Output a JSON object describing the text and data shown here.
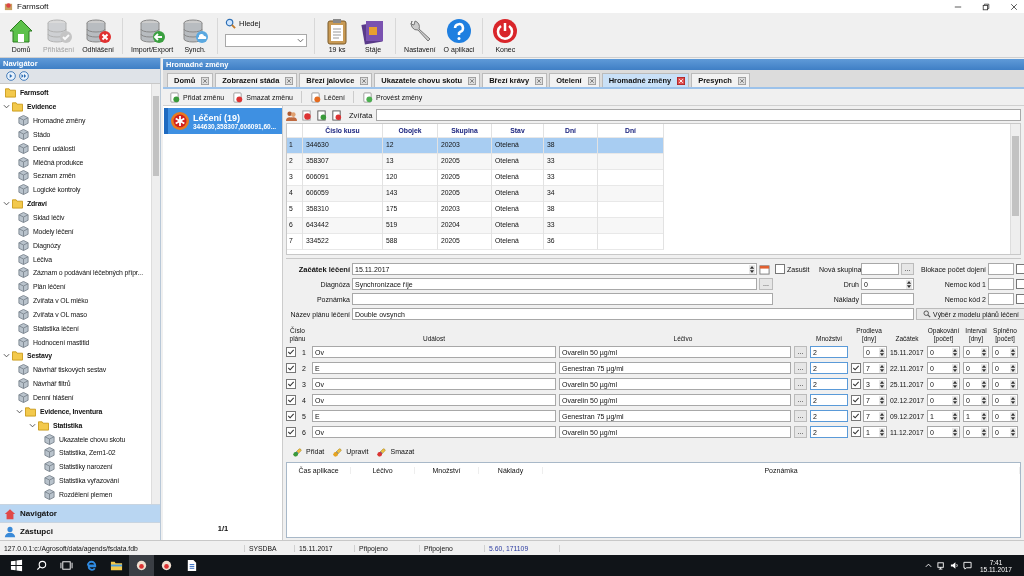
{
  "window": {
    "title": "Farmsoft"
  },
  "toolbar": {
    "buttons": [
      {
        "label": "Domů",
        "disabled": false
      },
      {
        "label": "Přihlášení",
        "disabled": true
      },
      {
        "label": "Odhlášení",
        "disabled": false
      },
      {
        "label": "Import/Export",
        "disabled": false
      },
      {
        "label": "Synch.",
        "disabled": false
      }
    ],
    "search": {
      "label": "Hledej"
    },
    "buttons_right": [
      {
        "label": "19 ks",
        "disabled": false
      },
      {
        "label": "Stáje",
        "disabled": false
      },
      {
        "label": "Nastavení",
        "disabled": false
      },
      {
        "label": "O aplikaci",
        "disabled": false
      },
      {
        "label": "Konec",
        "disabled": false
      }
    ]
  },
  "navigator": {
    "title": "Navigátor",
    "tree": [
      {
        "label": "Farmsoft",
        "children": [
          {
            "label": "Evidence",
            "expanded": true,
            "children": [
              {
                "label": "Hromadné změny"
              },
              {
                "label": "Stádo"
              },
              {
                "label": "Denní události"
              },
              {
                "label": "Mléčná produkce"
              },
              {
                "label": "Seznam změn"
              },
              {
                "label": "Logické kontroly"
              }
            ]
          },
          {
            "label": "Zdraví",
            "expanded": true,
            "children": [
              {
                "label": "Sklad léčiv"
              },
              {
                "label": "Modely léčení"
              },
              {
                "label": "Diagnózy"
              },
              {
                "label": "Léčiva"
              },
              {
                "label": "Záznam o podávání léčebných přípr..."
              },
              {
                "label": "Plán léčení"
              },
              {
                "label": "Zvířata v OL mléko"
              },
              {
                "label": "Zvířata v OL maso"
              },
              {
                "label": "Statistika léčení"
              },
              {
                "label": "Hodnocení mastitid"
              }
            ]
          },
          {
            "label": "Sestavy",
            "expanded": true,
            "children": [
              {
                "label": "Návrhář tiskových sestav"
              },
              {
                "label": "Návrhář filtrů"
              },
              {
                "label": "Denní hlášení"
              },
              {
                "label": "Evidence, Inventura",
                "expanded": true,
                "children": [
                  {
                    "label": "Statistika",
                    "expanded": true,
                    "children": [
                      {
                        "label": "Ukazatele chovu skotu"
                      },
                      {
                        "label": "Statistika, Zem1-02"
                      },
                      {
                        "label": "Statistiky narození"
                      },
                      {
                        "label": "Statistika vyřazování"
                      },
                      {
                        "label": "Rozdělení plemen"
                      }
                    ]
                  }
                ]
              }
            ]
          }
        ]
      }
    ],
    "sections": [
      {
        "label": "Navigátor",
        "selected": true
      },
      {
        "label": "Zástupci",
        "selected": false
      }
    ]
  },
  "main": {
    "title": "Hromadné změny",
    "tabs": [
      {
        "label": "Domů",
        "selected": false
      },
      {
        "label": "Zobrazení stáda",
        "selected": false
      },
      {
        "label": "Březí jalovice",
        "selected": false
      },
      {
        "label": "Ukazatele chovu skotu",
        "selected": false
      },
      {
        "label": "Březí krávy",
        "selected": false
      },
      {
        "label": "Otelení",
        "selected": false
      },
      {
        "label": "Hromadné změny",
        "selected": true
      },
      {
        "label": "Presynch",
        "selected": false
      }
    ],
    "actions": [
      {
        "label": "Přidat změnu"
      },
      {
        "label": "Smazat změnu"
      },
      {
        "label": "Léčení"
      },
      {
        "label": "Provést změny"
      }
    ],
    "changes": [
      {
        "title": "Léčení (19)",
        "detail": "344630,358307,606091,60...",
        "selected": true
      }
    ],
    "pager": "1/1",
    "animals": {
      "filter_label": "Zvířata",
      "columns": [
        "Číslo kusu",
        "Obojek",
        "Skupina",
        "Stav",
        "Dní",
        "Dní"
      ],
      "rows": [
        {
          "number": "1",
          "cells": [
            "344630",
            "12",
            "20203",
            "Otelená",
            "38"
          ],
          "selected": true
        },
        {
          "number": "2",
          "cells": [
            "358307",
            "13",
            "20205",
            "Otelená",
            "33"
          ],
          "selected": false
        },
        {
          "number": "3",
          "cells": [
            "606091",
            "120",
            "20205",
            "Otelená",
            "33"
          ],
          "selected": false
        },
        {
          "number": "4",
          "cells": [
            "606059",
            "143",
            "20205",
            "Otelená",
            "34"
          ],
          "selected": false
        },
        {
          "number": "5",
          "cells": [
            "358310",
            "175",
            "20203",
            "Otelená",
            "38"
          ],
          "selected": false
        },
        {
          "number": "6",
          "cells": [
            "643442",
            "519",
            "20204",
            "Otelená",
            "33"
          ],
          "selected": false
        },
        {
          "number": "7",
          "cells": [
            "334522",
            "588",
            "20205",
            "Otelená",
            "36"
          ],
          "selected": false
        }
      ]
    },
    "treatment": {
      "start_label": "Začátek léčení",
      "start": "15.11.2017",
      "dry_off_label": "Zasušit",
      "dry_off_checked": false,
      "new_group_label": "Nová skupina",
      "new_group_button": "...",
      "diagnosis_button": "...",
      "block_label": "Blokace počet dojení",
      "block_checked": false,
      "diagnosis_label": "Diagnóza",
      "diagnosis": "Synchronizace říje",
      "type_label": "Druh",
      "type_value": "0",
      "disease1_label": "Nemoc kód 1",
      "disease1_checked": false,
      "note_label": "Poznámka",
      "costs_label": "Náklady",
      "disease2_label": "Nemoc kód 2",
      "disease2_checked": false,
      "plan_name_label": "Název plánu léčení",
      "plan_name": "Double ovsynch",
      "model_button": "Výběr z modelu plánů léčení"
    },
    "plan": {
      "headers": [
        "Číslo plánu",
        "Událost",
        "Léčivo",
        "Množství",
        "Prodleva [dny]",
        "Začátek",
        "Opakování [počet]",
        "Interval [dny]",
        "Splněno [počet]"
      ],
      "rows": [
        {
          "checked": true,
          "number": "1",
          "event": "Ov",
          "drug": "Ovarelin 50 µg/ml",
          "drug_button": "...",
          "quantity": "2",
          "delay": "0",
          "start": "15.11.2017",
          "repeat": "0",
          "interval": "0",
          "done": "0"
        },
        {
          "checked": true,
          "number": "2",
          "event": "E",
          "drug": "Genestran 75 µg/ml",
          "drug_button": "...",
          "quantity": "2",
          "delay_checked": true,
          "delay": "7",
          "start": "22.11.2017",
          "repeat": "0",
          "interval": "0",
          "done": "0"
        },
        {
          "checked": true,
          "number": "3",
          "event": "Ov",
          "drug": "Ovarelin 50 µg/ml",
          "drug_button": "...",
          "quantity": "2",
          "delay_checked": true,
          "delay": "3",
          "start": "25.11.2017",
          "repeat": "0",
          "interval": "0",
          "done": "0"
        },
        {
          "checked": true,
          "number": "4",
          "event": "Ov",
          "drug": "Ovarelin 50 µg/ml",
          "drug_button": "...",
          "quantity": "2",
          "delay_checked": true,
          "delay": "7",
          "start": "02.12.2017",
          "repeat": "0",
          "interval": "0",
          "done": "0"
        },
        {
          "checked": true,
          "number": "5",
          "event": "E",
          "drug": "Genestran 75 µg/ml",
          "drug_button": "...",
          "quantity": "2",
          "delay_checked": true,
          "delay": "7",
          "start": "09.12.2017",
          "repeat": "1",
          "interval": "1",
          "done": "0"
        },
        {
          "checked": true,
          "number": "6",
          "event": "Ov",
          "drug": "Ovarelin 50 µg/ml",
          "drug_button": "...",
          "quantity": "2",
          "delay_checked": true,
          "delay": "1",
          "start": "11.12.2017",
          "repeat": "0",
          "interval": "0",
          "done": "0"
        }
      ]
    },
    "applications": {
      "actions": [
        {
          "label": "Přidat"
        },
        {
          "label": "Upravit"
        },
        {
          "label": "Smazat"
        }
      ],
      "columns": [
        "Čas aplikace",
        "Léčivo",
        "Množství",
        "Náklady",
        "Poznámka"
      ]
    }
  },
  "status_bar": [
    "127.0.0.1:c:/Agrosoft/data/agends/fsdata.fdb",
    "SYSDBA",
    "15.11.2017",
    "Připojeno",
    "Připojeno",
    "5.60, 171109"
  ],
  "taskbar": {
    "time": "7:41",
    "date": "15.11.2017"
  }
}
